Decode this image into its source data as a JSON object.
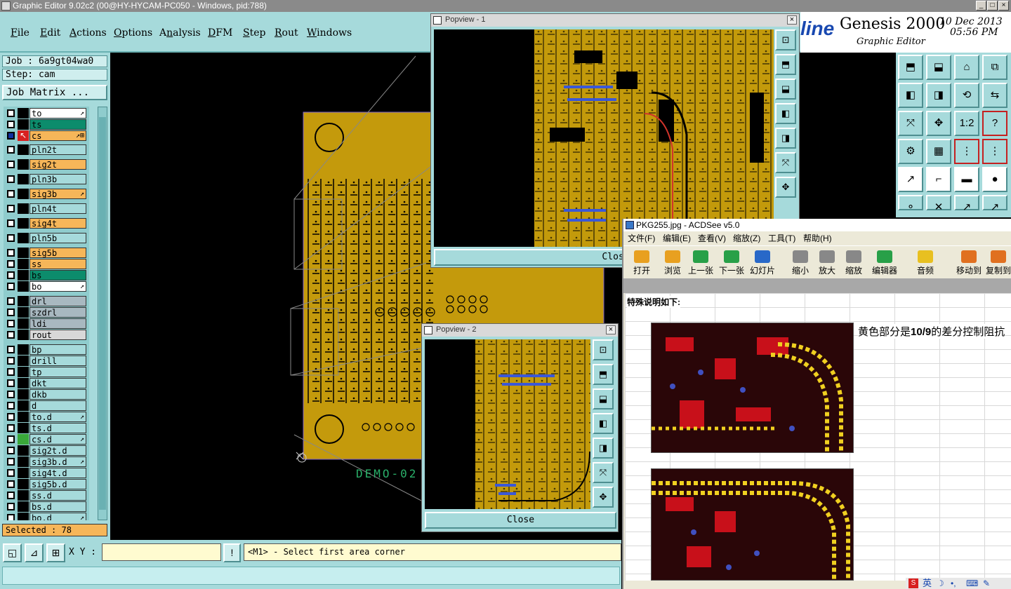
{
  "titlebar": {
    "title": "Graphic Editor 9.02c2 (00@HY-HYCAM-PC050 - Windows, pid:788)"
  },
  "menu": [
    {
      "label": "File",
      "mnemonic": "F"
    },
    {
      "label": "Edit",
      "mnemonic": "E"
    },
    {
      "label": "Actions",
      "mnemonic": "A"
    },
    {
      "label": "Options",
      "mnemonic": "O"
    },
    {
      "label": "Analysis",
      "mnemonic": "n"
    },
    {
      "label": "DFM",
      "mnemonic": "D"
    },
    {
      "label": "Step",
      "mnemonic": "S"
    },
    {
      "label": "Rout",
      "mnemonic": "R"
    },
    {
      "label": "Windows",
      "mnemonic": "W"
    }
  ],
  "job": {
    "job_label": "Job : 6a9gt04wa0",
    "step_label": "Step: cam",
    "matrix_button": "Job Matrix ..."
  },
  "layers": [
    {
      "name": "to",
      "color": "#ffffff",
      "sym": "↗"
    },
    {
      "name": "ts",
      "color": "#0c8c6c",
      "sym": ""
    },
    {
      "name": "cs",
      "color": "#f6b659",
      "sym": "↗⊞",
      "active": true
    },
    {
      "name": "pln2t",
      "color": "#a6dadb",
      "sym": ""
    },
    {
      "name": "sig2t",
      "color": "#f6b659",
      "sym": ""
    },
    {
      "name": "pln3b",
      "color": "#a6dadb",
      "sym": ""
    },
    {
      "name": "sig3b",
      "color": "#f6b659",
      "sym": "↗"
    },
    {
      "name": "pln4t",
      "color": "#a6dadb",
      "sym": ""
    },
    {
      "name": "sig4t",
      "color": "#f6b659",
      "sym": ""
    },
    {
      "name": "pln5b",
      "color": "#a6dadb",
      "sym": ""
    },
    {
      "name": "sig5b",
      "color": "#f6b659",
      "sym": ""
    },
    {
      "name": "ss",
      "color": "#f6b659",
      "sym": ""
    },
    {
      "name": "bs",
      "color": "#0c8c6c",
      "sym": ""
    },
    {
      "name": "bo",
      "color": "#ffffff",
      "sym": "↗"
    },
    {
      "name": "drl",
      "color": "#a8b8c0",
      "sym": ""
    },
    {
      "name": "szdrl",
      "color": "#a8b8c0",
      "sym": ""
    },
    {
      "name": "ldi",
      "color": "#a8b8c0",
      "sym": ""
    },
    {
      "name": "rout",
      "color": "#d8d8d8",
      "sym": ""
    },
    {
      "name": "bp",
      "color": "#a6dadb",
      "sym": ""
    },
    {
      "name": "drill",
      "color": "#a6dadb",
      "sym": ""
    },
    {
      "name": "tp",
      "color": "#a6dadb",
      "sym": ""
    },
    {
      "name": "dkt",
      "color": "#a6dadb",
      "sym": ""
    },
    {
      "name": "dkb",
      "color": "#a6dadb",
      "sym": ""
    },
    {
      "name": "d",
      "color": "#a6dadb",
      "sym": ""
    },
    {
      "name": "to.d",
      "color": "#a6dadb",
      "sym": "↗"
    },
    {
      "name": "ts.d",
      "color": "#a6dadb",
      "sym": ""
    },
    {
      "name": "cs.d",
      "color": "#a6dadb",
      "sym": "↗",
      "mark": "#3aa83a"
    },
    {
      "name": "sig2t.d",
      "color": "#a6dadb",
      "sym": ""
    },
    {
      "name": "sig3b.d",
      "color": "#a6dadb",
      "sym": "↗"
    },
    {
      "name": "sig4t.d",
      "color": "#a6dadb",
      "sym": ""
    },
    {
      "name": "sig5b.d",
      "color": "#a6dadb",
      "sym": ""
    },
    {
      "name": "ss.d",
      "color": "#a6dadb",
      "sym": ""
    },
    {
      "name": "bs.d",
      "color": "#a6dadb",
      "sym": ""
    },
    {
      "name": "bo.d",
      "color": "#a6dadb",
      "sym": "↗"
    }
  ],
  "selected": "Selected : 78",
  "bottom": {
    "xy_label": "X Y :",
    "xy_value": "",
    "message": "<M1> - Select first area corner",
    "excl": "!"
  },
  "canvas": {
    "board_label": "DEMO-02"
  },
  "genesis": {
    "brand_fragment": "line",
    "product": "Genesis 2000",
    "subtitle": "Graphic Editor",
    "date": "10 Dec 2013",
    "time": "05:56 PM"
  },
  "popview1": {
    "title": "Popview - 1",
    "close": "Close"
  },
  "popview2": {
    "title": "Popview - 2",
    "close": "Close"
  },
  "acdsee": {
    "title": "PKG255.jpg - ACDSee v5.0",
    "menu": [
      "文件(F)",
      "编辑(E)",
      "查看(V)",
      "缩放(Z)",
      "工具(T)",
      "帮助(H)"
    ],
    "toolbar": [
      "打开",
      "浏览",
      "上一张",
      "下一张",
      "幻灯片",
      "缩小",
      "放大",
      "缩放",
      "编辑器",
      "音频",
      "移动到",
      "复制到"
    ],
    "note": "特殊说明如下:",
    "desc_pre": "黄色部分是",
    "desc_bold": "10/9",
    "desc_post": "的差分控制阻抗"
  },
  "tray": {
    "lang": "英"
  },
  "colors": {
    "teal": "#a6dadb",
    "copper": "#c49a0c",
    "orange": "#f6b659",
    "green": "#0c8c6c"
  }
}
